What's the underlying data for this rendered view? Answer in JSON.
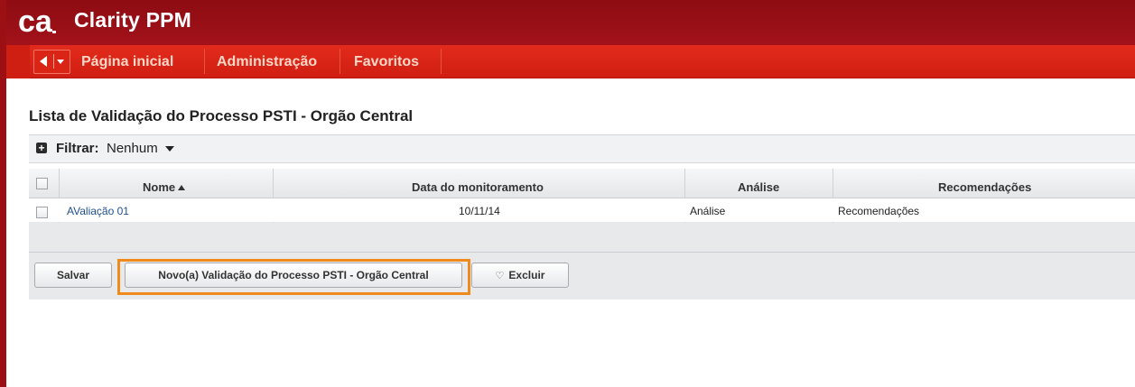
{
  "app": {
    "logo_text": "ca",
    "title": "Clarity PPM"
  },
  "nav": {
    "items": [
      {
        "label": "Página inicial"
      },
      {
        "label": "Administração"
      },
      {
        "label": "Favoritos"
      }
    ]
  },
  "page": {
    "title": "Lista de Validação do Processo PSTI - Orgão Central"
  },
  "filter": {
    "label": "Filtrar:",
    "value": "Nenhum"
  },
  "grid": {
    "columns": [
      "Nome",
      "Data do monitoramento",
      "Análise",
      "Recomendações"
    ],
    "sorted_column": "Nome",
    "rows": [
      {
        "nome": "AValiação 01",
        "data": "10/11/14",
        "analise": "Análise",
        "recomendacoes": "Recomendações"
      }
    ]
  },
  "actions": {
    "save_label": "Salvar",
    "new_label": "Novo(a) Validação do Processo PSTI - Orgão Central",
    "delete_label": "Excluir"
  },
  "colors": {
    "header_dark": "#9c0f12",
    "nav_red": "#d92416",
    "highlight_orange": "#f08a1c",
    "link_blue": "#1f4f8f"
  }
}
